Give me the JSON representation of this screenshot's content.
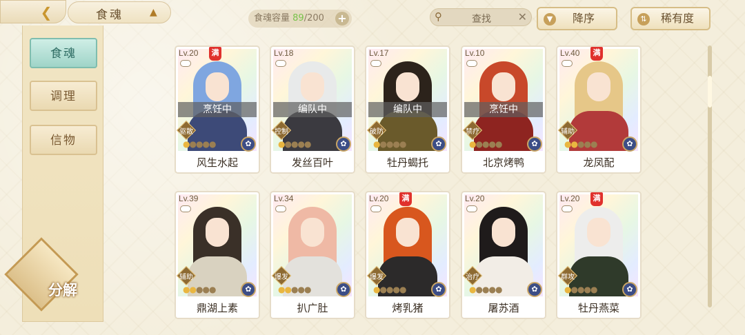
{
  "header": {
    "title": "食魂",
    "capacity_label": "食魂容量",
    "capacity_current": "89",
    "capacity_total": "/200",
    "plus_label": "+",
    "search_label": "查找",
    "sort_order_label": "降序",
    "sort_rarity_label": "稀有度"
  },
  "sidebar": {
    "items": [
      {
        "label": "食魂"
      },
      {
        "label": "调理"
      },
      {
        "label": "信物"
      }
    ],
    "decompose_label": "分解"
  },
  "cards": [
    {
      "level": "Lv.20",
      "full": "满",
      "status": "烹饪中",
      "role": "驱散",
      "stars_lit": 1,
      "name": "风生水起",
      "hair": "#7fa6e0",
      "body": "#3d4a78"
    },
    {
      "level": "Lv.18",
      "full": "",
      "status": "编队中",
      "role": "控制",
      "stars_lit": 1,
      "name": "发丝百叶",
      "hair": "#e8eaea",
      "body": "#3b3a40"
    },
    {
      "level": "Lv.17",
      "full": "",
      "status": "编队中",
      "role": "破防",
      "stars_lit": 1,
      "name": "牡丹蝎托",
      "hair": "#2c231b",
      "body": "#6a5a2b"
    },
    {
      "level": "Lv.10",
      "full": "",
      "status": "烹饪中",
      "role": "禁疗",
      "stars_lit": 1,
      "name": "北京烤鸭",
      "hair": "#c8482a",
      "body": "#8e2420"
    },
    {
      "level": "Lv.40",
      "full": "满",
      "status": "",
      "role": "辅助",
      "stars_lit": 2,
      "name": "龙凤配",
      "hair": "#e6c788",
      "body": "#b23a3a"
    },
    {
      "level": "Lv.39",
      "full": "",
      "status": "",
      "role": "辅助",
      "stars_lit": 2,
      "name": "鼎湖上素",
      "hair": "#3a3028",
      "body": "#d9d2c0"
    },
    {
      "level": "Lv.34",
      "full": "",
      "status": "",
      "role": "爆发",
      "stars_lit": 2,
      "name": "扒广肚",
      "hair": "#efb9a5",
      "body": "#e3e1dc"
    },
    {
      "level": "Lv.20",
      "full": "满",
      "status": "",
      "role": "爆发",
      "stars_lit": 1,
      "name": "烤乳猪",
      "hair": "#d8571e",
      "body": "#2c2a2a"
    },
    {
      "level": "Lv.20",
      "full": "",
      "status": "",
      "role": "治疗",
      "stars_lit": 1,
      "name": "屠苏酒",
      "hair": "#1f1b1b",
      "body": "#f2ede6"
    },
    {
      "level": "Lv.20",
      "full": "满",
      "status": "",
      "role": "群攻",
      "stars_lit": 1,
      "name": "牡丹燕菜",
      "hair": "#ededec",
      "body": "#2f3a2a"
    }
  ],
  "star_glyph": "●",
  "skill_glyph": "✿",
  "icons": [
    "back-arrow-icon",
    "hat-icon",
    "search-icon",
    "clear-icon",
    "down-arrow-icon",
    "sort-icon",
    "shield-icon",
    "role-diamond-icon",
    "skill-icon"
  ]
}
